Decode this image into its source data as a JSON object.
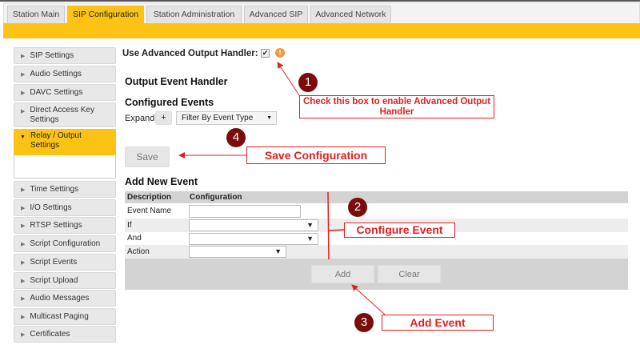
{
  "tabs": [
    "Station Main",
    "SIP Configuration",
    "Station Administration",
    "Advanced SIP",
    "Advanced Network"
  ],
  "sidebar": [
    "SIP Settings",
    "Audio Settings",
    "DAVC Settings",
    "Direct Access Key Settings",
    "Relay / Output Settings",
    "Time Settings",
    "I/O Settings",
    "RTSP Settings",
    "Script Configuration",
    "Script Events",
    "Script Upload",
    "Audio Messages",
    "Multicast Paging",
    "Certificates"
  ],
  "main": {
    "use_advanced_label": "Use Advanced Output Handler:",
    "use_advanced_checked": true,
    "output_event_handler": "Output Event Handler",
    "configured_events": "Configured Events",
    "expand_label": "Expand",
    "expand_button": "+",
    "filter_select": "Filter By Event Type",
    "save_button": "Save",
    "add_new_event": "Add New Event",
    "table_headers": [
      "Description",
      "Configuration"
    ],
    "rows": [
      "Event Name",
      "If",
      "And",
      "Action"
    ],
    "add_button": "Add",
    "clear_button": "Clear"
  },
  "annotations": {
    "c1": "1",
    "t1": "Check this box to enable Advanced Output Handler",
    "c2": "2",
    "t2": "Configure Event",
    "c3": "3",
    "t3": "Add Event",
    "c4": "4",
    "t4": "Save Configuration"
  },
  "colors": {
    "accent": "#fcc315",
    "callout": "#e02020",
    "marker": "#7a0c0c"
  }
}
